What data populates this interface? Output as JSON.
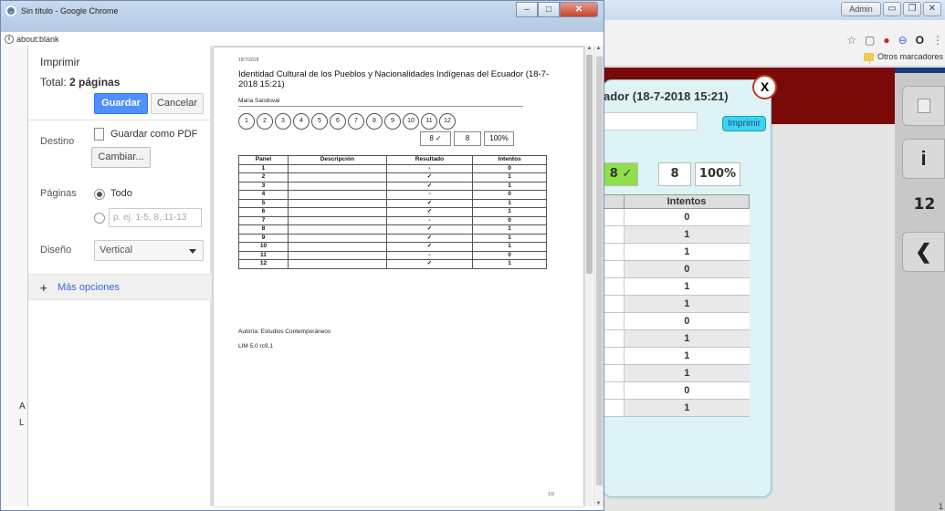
{
  "window": {
    "title": "Sin título - Google Chrome",
    "address": "about:blank"
  },
  "print_panel": {
    "title": "Imprimir",
    "total_prefix": "Total:",
    "total_value": "2 páginas",
    "save_label": "Guardar",
    "cancel_label": "Cancelar",
    "destination_label": "Destino",
    "destination_value": "Guardar como PDF",
    "change_label": "Cambiar...",
    "pages_label": "Páginas",
    "pages_all_label": "Todo",
    "pages_placeholder": "p. ej. 1-5, 8, 11-13",
    "layout_label": "Diseño",
    "layout_value": "Vertical",
    "more_options_label": "Más opciones"
  },
  "preview": {
    "date": "18/7/2018",
    "title": "Identidad Cultural de los Pueblos y Nacionalidades Indígenas del Ecuador (18-7-2018 15:21)",
    "author": "Maria Sandoval",
    "circles": [
      "1",
      "2",
      "3",
      "4",
      "5",
      "6",
      "7",
      "8",
      "9",
      "10",
      "11",
      "12"
    ],
    "score_ok": "8 ✓",
    "score_n": "8",
    "score_pct": "100%",
    "table_headers": [
      "Panel",
      "Descripción",
      "Resultado",
      "Intentos"
    ],
    "table_rows": [
      [
        "1",
        "",
        "-",
        "0"
      ],
      [
        "2",
        "",
        "✓",
        "1"
      ],
      [
        "3",
        "",
        "✓",
        "1"
      ],
      [
        "4",
        "",
        "-",
        "0"
      ],
      [
        "5",
        "",
        "✓",
        "1"
      ],
      [
        "6",
        "",
        "✓",
        "1"
      ],
      [
        "7",
        "",
        "-",
        "0"
      ],
      [
        "8",
        "",
        "✓",
        "1"
      ],
      [
        "9",
        "",
        "✓",
        "1"
      ],
      [
        "10",
        "",
        "✓",
        "1"
      ],
      [
        "11",
        "",
        "-",
        "0"
      ],
      [
        "12",
        "",
        "✓",
        "1"
      ]
    ],
    "footer1": "Autoría: Estudios Contemporáneos",
    "footer2": "LIM 5.0 rc9.1",
    "page_number": "1/2"
  },
  "background": {
    "user_badge": "Admin",
    "bookmark_folder": "Otros marcadores",
    "dialog_title": "ador (18-7-2018 15:21)",
    "dialog_print": "Imprimir",
    "dialog_close": "X",
    "score_ok": "8 ✓",
    "score_n": "8",
    "score_pct": "100%",
    "table_header": "Intentos",
    "intentos": [
      "0",
      "1",
      "1",
      "0",
      "1",
      "1",
      "0",
      "1",
      "1",
      "1",
      "0",
      "1"
    ],
    "side_info": "i",
    "side_count": "12",
    "side_back": "❮",
    "page_corner": "1"
  },
  "colors": {
    "save_button": "#4d90fe",
    "red_band": "#7a0a0a",
    "dialog_bg": "#ddf3f6",
    "score_ok_bg": "#8ee04a",
    "print_btn": "#3fd3f0"
  }
}
